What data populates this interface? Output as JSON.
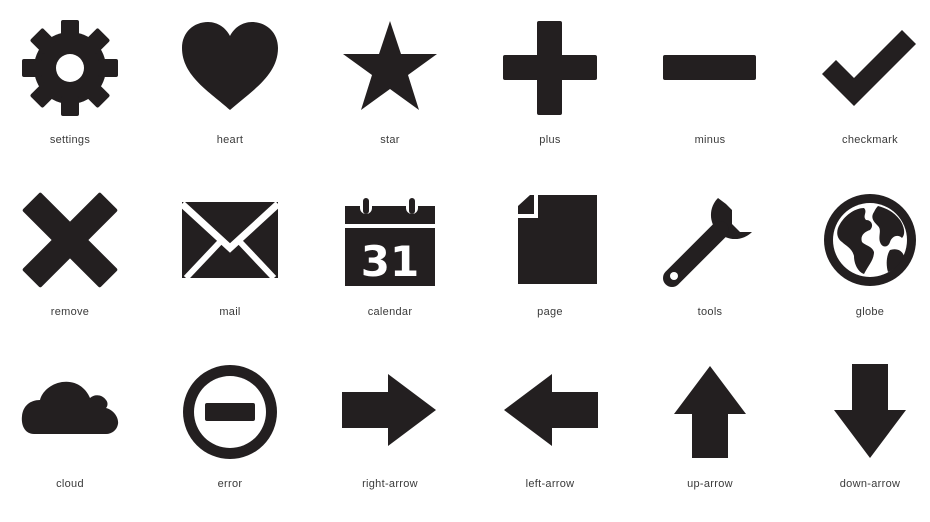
{
  "icons": [
    {
      "name": "settings",
      "label": "settings"
    },
    {
      "name": "heart",
      "label": "heart"
    },
    {
      "name": "star",
      "label": "star"
    },
    {
      "name": "plus",
      "label": "plus"
    },
    {
      "name": "minus",
      "label": "minus"
    },
    {
      "name": "checkmark",
      "label": "checkmark"
    },
    {
      "name": "remove",
      "label": "remove"
    },
    {
      "name": "mail",
      "label": "mail"
    },
    {
      "name": "calendar",
      "label": "calendar",
      "glyph_text": "31"
    },
    {
      "name": "page",
      "label": "page"
    },
    {
      "name": "tools",
      "label": "tools"
    },
    {
      "name": "globe",
      "label": "globe"
    },
    {
      "name": "cloud",
      "label": "cloud"
    },
    {
      "name": "error",
      "label": "error"
    },
    {
      "name": "right-arrow",
      "label": "right-arrow"
    },
    {
      "name": "left-arrow",
      "label": "left-arrow"
    },
    {
      "name": "up-arrow",
      "label": "up-arrow"
    },
    {
      "name": "down-arrow",
      "label": "down-arrow"
    }
  ],
  "colors": {
    "icon_fill": "#231f20",
    "label_text": "#3a3a3a",
    "background": "#ffffff"
  }
}
